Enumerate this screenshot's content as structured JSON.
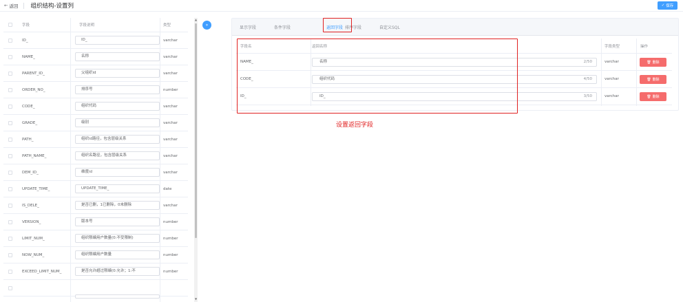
{
  "header": {
    "back_label": "返回",
    "title": "组织结构-设置列",
    "save_label": "保存"
  },
  "left_table": {
    "columns": [
      "字段",
      "字段说明",
      "类型"
    ],
    "rows": [
      {
        "field": "ID_",
        "desc": "ID_",
        "type": "varchar"
      },
      {
        "field": "NAME_",
        "desc": "名称",
        "type": "varchar"
      },
      {
        "field": "PARENT_ID_",
        "desc": "父组织id",
        "type": "varchar"
      },
      {
        "field": "ORDER_NO_",
        "desc": "排序号",
        "type": "number"
      },
      {
        "field": "CODE_",
        "desc": "组织代码",
        "type": "varchar"
      },
      {
        "field": "GRADE_",
        "desc": "级别",
        "type": "varchar"
      },
      {
        "field": "PATH_",
        "desc": "组织id路径，包含层级关系",
        "type": "varchar"
      },
      {
        "field": "PATH_NAME_",
        "desc": "组织名路径，包含层级关系",
        "type": "varchar"
      },
      {
        "field": "DEM_ID_",
        "desc": "维度id",
        "type": "varchar"
      },
      {
        "field": "UPDATE_TIME_",
        "desc": "UPDATE_TIME_",
        "type": "date"
      },
      {
        "field": "IS_DELE_",
        "desc": "是否已删，1已删除，0未删除",
        "type": "varchar"
      },
      {
        "field": "VERSION_",
        "desc": "版本号",
        "type": "number"
      },
      {
        "field": "LIMIT_NUM_",
        "desc": "组织限编用户数量(0:不受限制)",
        "type": "number"
      },
      {
        "field": "NOW_NUM_",
        "desc": "组织限编用户数量",
        "type": "number"
      },
      {
        "field": "EXCEED_LIMIT_NUM_",
        "desc": "是否允许超过限编(0:允许；1:不",
        "type": "number"
      }
    ]
  },
  "tabs": [
    "显示字段",
    "条件字段",
    "返回字段",
    "排序字段",
    "自定义SQL"
  ],
  "active_tab": "返回字段",
  "return_table": {
    "columns": [
      "字段名",
      "返回名称",
      "字段类型",
      "操作"
    ],
    "rows": [
      {
        "field": "NAME_",
        "name": "名称",
        "count": "2/50",
        "type": "varchar",
        "action": "删除"
      },
      {
        "field": "CODE_",
        "name": "组织代码",
        "count": "4/50",
        "type": "varchar",
        "action": "删除"
      },
      {
        "field": "ID_",
        "name": "ID_",
        "count": "3/50",
        "type": "varchar",
        "action": "删除"
      }
    ]
  },
  "annotation": "设置返回字段",
  "colors": {
    "primary": "#409eff",
    "danger": "#f56c6c",
    "annotation": "#e02020"
  },
  "icons": {
    "back": "arrow-left-icon",
    "save": "check-icon",
    "expand": "chevron-right-icon",
    "delete": "trash-icon"
  }
}
